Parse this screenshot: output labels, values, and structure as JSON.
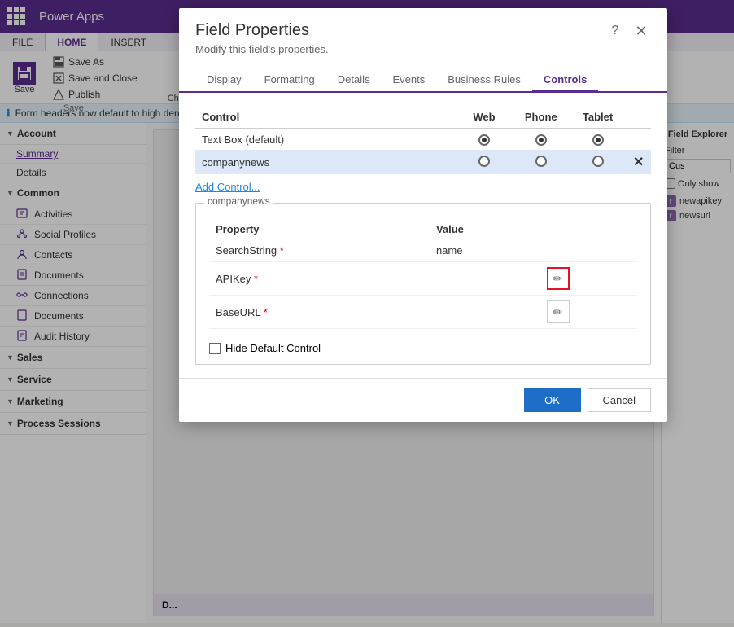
{
  "app": {
    "title": "Power Apps"
  },
  "ribbon": {
    "tabs": [
      "FILE",
      "HOME",
      "INSERT"
    ],
    "active_tab": "HOME",
    "save_label": "Save",
    "save_as_label": "Save As",
    "save_close_label": "Save and Close",
    "publish_label": "Publish",
    "change_props_label": "Change\nProperties",
    "group_label": "Save"
  },
  "info_bar": {
    "text": "Form headers now default to high den..."
  },
  "sidebar": {
    "sections": [
      {
        "name": "Account",
        "items": [
          {
            "label": "Summary",
            "active": true
          },
          {
            "label": "Details",
            "active": false
          }
        ]
      },
      {
        "name": "Common",
        "items": [
          {
            "label": "Activities"
          },
          {
            "label": "Social Profiles"
          },
          {
            "label": "Contacts"
          },
          {
            "label": "Documents"
          },
          {
            "label": "Connections"
          },
          {
            "label": "Documents"
          },
          {
            "label": "Audit History"
          }
        ]
      },
      {
        "name": "Sales",
        "items": []
      },
      {
        "name": "Service",
        "items": []
      },
      {
        "name": "Marketing",
        "items": []
      },
      {
        "name": "Process Sessions",
        "items": []
      }
    ]
  },
  "right_panel": {
    "title": "Field Explorer",
    "filter_label": "Filter",
    "filter_placeholder": "Cus",
    "only_show_label": "Only show",
    "fields": [
      {
        "label": "newapikey"
      },
      {
        "label": "newsurl"
      }
    ]
  },
  "modal": {
    "title": "Field Properties",
    "subtitle": "Modify this field's properties.",
    "tabs": [
      "Display",
      "Formatting",
      "Details",
      "Events",
      "Business Rules",
      "Controls"
    ],
    "active_tab": "Controls",
    "table": {
      "headers": {
        "control": "Control",
        "web": "Web",
        "phone": "Phone",
        "tablet": "Tablet"
      },
      "rows": [
        {
          "label": "Text Box (default)",
          "web_checked": true,
          "phone_checked": true,
          "tablet_checked": true,
          "highlighted": false,
          "deletable": false
        },
        {
          "label": "companynews",
          "web_checked": false,
          "phone_checked": false,
          "tablet_checked": false,
          "highlighted": true,
          "deletable": true
        }
      ]
    },
    "add_control_label": "Add Control...",
    "section_label": "companynews",
    "properties": {
      "headers": {
        "property": "Property",
        "value": "Value"
      },
      "rows": [
        {
          "name": "SearchString",
          "required": true,
          "value": "name",
          "editable": false
        },
        {
          "name": "APIKey",
          "required": true,
          "value": "",
          "editable": true,
          "highlighted": true
        },
        {
          "name": "BaseURL",
          "required": true,
          "value": "",
          "editable": true,
          "highlighted": false
        }
      ]
    },
    "hide_default_label": "Hide Default Control",
    "ok_label": "OK",
    "cancel_label": "Cancel"
  },
  "center_bottom": {
    "label": "D..."
  }
}
